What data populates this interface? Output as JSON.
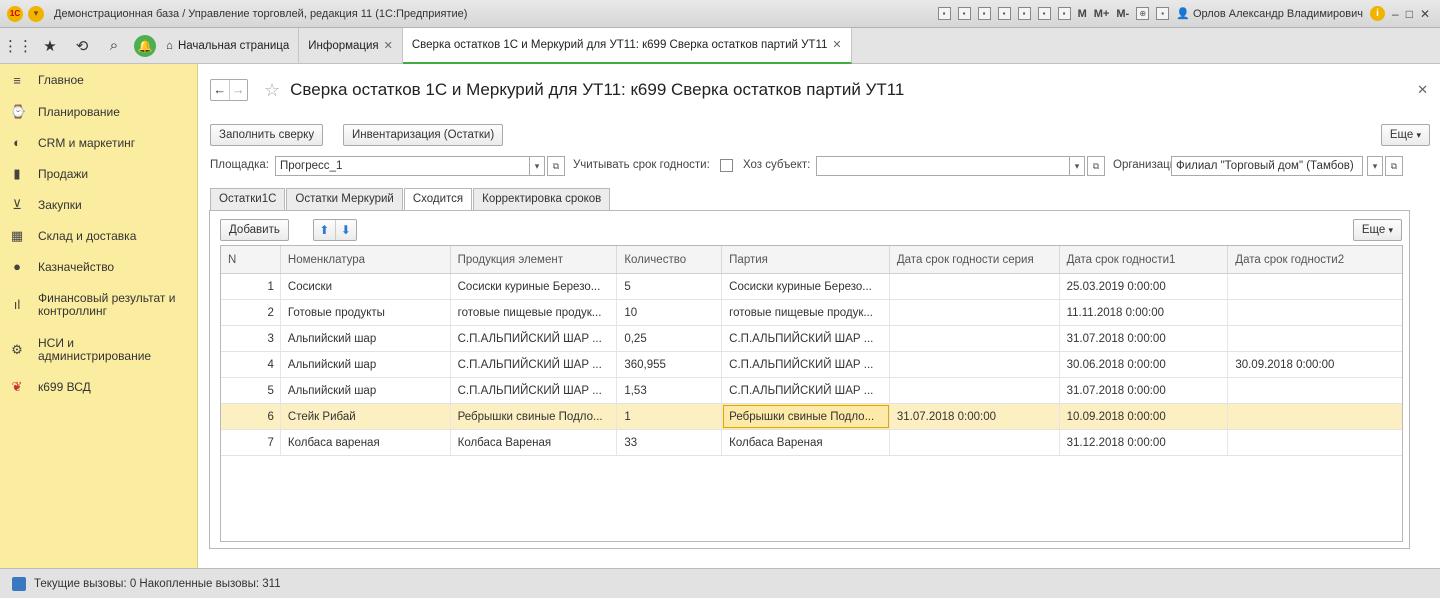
{
  "window": {
    "title": "Демонстрационная база / Управление торговлей, редакция 11  (1С:Предприятие)",
    "logo_text": "1С",
    "toolbar_m": "M",
    "toolbar_mplus": "M+",
    "toolbar_mminus": "M-",
    "user": "Орлов Александр Владимирович",
    "info_label": "i",
    "minimize": "–",
    "maximize": "□",
    "close": "✕"
  },
  "tabs": [
    {
      "label": "Начальная страница"
    },
    {
      "label": "Информация"
    },
    {
      "label": "Сверка остатков 1С и Меркурий для УТ11: к699 Сверка остатков партий УТ11"
    }
  ],
  "sidebar": {
    "items": [
      {
        "label": "Главное",
        "icon": "menu-icon"
      },
      {
        "label": "Планирование",
        "icon": "planning-icon"
      },
      {
        "label": "CRM и маркетинг",
        "icon": "crm-icon"
      },
      {
        "label": "Продажи",
        "icon": "bag-icon"
      },
      {
        "label": "Закупки",
        "icon": "cart-icon"
      },
      {
        "label": "Склад и доставка",
        "icon": "warehouse-icon"
      },
      {
        "label": "Казначейство",
        "icon": "treasury-icon"
      },
      {
        "label": "Финансовый результат и контроллинг",
        "icon": "chart-icon"
      },
      {
        "label": "НСИ и администрирование",
        "icon": "gear-icon"
      },
      {
        "label": "к699 ВСД",
        "icon": "vsd-icon"
      }
    ]
  },
  "form": {
    "title": "Сверка остатков 1С и Меркурий для УТ11: к699 Сверка остатков партий УТ11",
    "fill_button": "Заполнить сверку",
    "inventory_button": "Инвентаризация (Остатки)",
    "more_button": "Еще",
    "site_label": "Площадка:",
    "site_value": "Прогресс_1",
    "expiry_label": "Учитывать срок годности:",
    "subject_label": "Хоз субъект:",
    "subject_value": "",
    "org_label": "Организация:",
    "org_value": "Филиал \"Торговый дом\" (Тамбов)"
  },
  "form_tabs": [
    "Остатки1С",
    "Остатки Меркурий",
    "Сходится",
    "Корректировка сроков"
  ],
  "table_panel": {
    "add_button": "Добавить",
    "more_button": "Еще"
  },
  "table": {
    "columns": [
      "N",
      "Номенклатура",
      "Продукция элемент",
      "Количество",
      "Партия",
      "Дата срок годности серия",
      "Дата срок годности1",
      "Дата срок годности2"
    ],
    "rows": [
      [
        "1",
        "Сосиски",
        "Сосиски куриные Березо...",
        "5",
        "Сосиски куриные Березо...",
        "",
        "25.03.2019 0:00:00",
        ""
      ],
      [
        "2",
        "Готовые продукты",
        "готовые пищевые продук...",
        "10",
        "готовые пищевые продук...",
        "",
        "11.11.2018 0:00:00",
        ""
      ],
      [
        "3",
        "Альпийский шар",
        "С.П.АЛЬПИЙСКИЙ ШАР ...",
        "0,25",
        "С.П.АЛЬПИЙСКИЙ ШАР ...",
        "",
        "31.07.2018 0:00:00",
        ""
      ],
      [
        "4",
        "Альпийский шар",
        "С.П.АЛЬПИЙСКИЙ ШАР ...",
        "360,955",
        "С.П.АЛЬПИЙСКИЙ ШАР ...",
        "",
        "30.06.2018 0:00:00",
        "30.09.2018 0:00:00"
      ],
      [
        "5",
        "Альпийский шар",
        "С.П.АЛЬПИЙСКИЙ ШАР ...",
        "1,53",
        "С.П.АЛЬПИЙСКИЙ ШАР ...",
        "",
        "31.07.2018 0:00:00",
        ""
      ],
      [
        "6",
        "Стейк Рибай",
        "Ребрышки свиные Подло...",
        "1",
        "Ребрышки свиные Подло...",
        "31.07.2018 0:00:00",
        "10.09.2018 0:00:00",
        ""
      ],
      [
        "7",
        "Колбаса вареная",
        "Колбаса Вареная",
        "33",
        "Колбаса Вареная",
        "",
        "31.12.2018 0:00:00",
        ""
      ]
    ]
  },
  "status": {
    "text": "Текущие вызовы: 0   Накопленные вызовы: 311"
  }
}
